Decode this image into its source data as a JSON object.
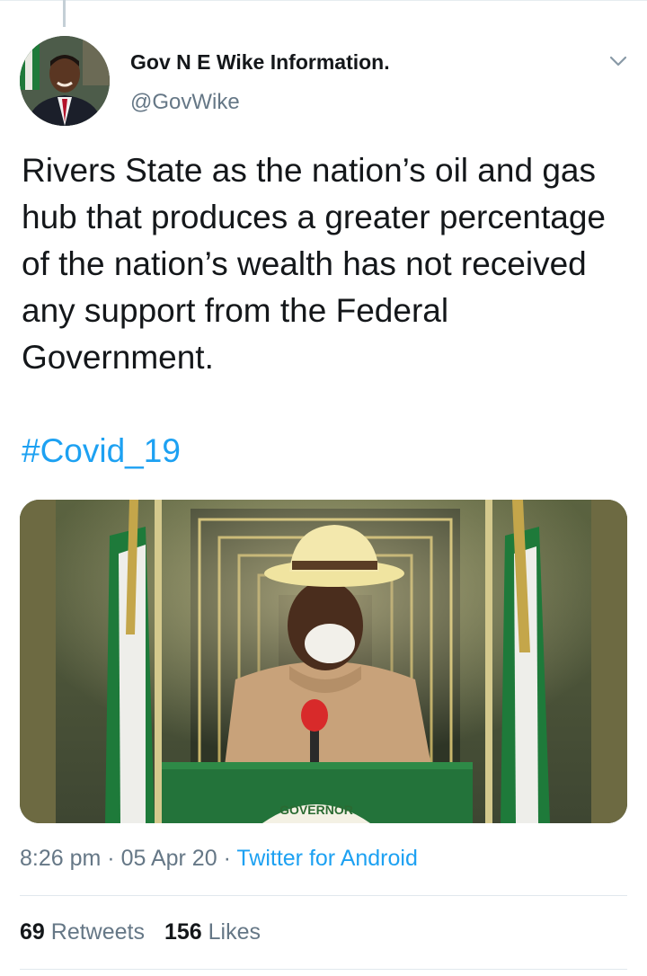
{
  "tweet": {
    "author": {
      "display_name": "Gov N E Wike Information.",
      "handle": "@GovWike"
    },
    "text": "Rivers State as the nation’s oil and gas hub that produces a greater percentage of the nation’s wealth has not received any support from the Federal Government.",
    "hashtag": "#Covid_19",
    "media": {
      "podium_text": "GOVERNOR"
    },
    "time": "8:26 pm",
    "separator": "·",
    "date": "05 Apr 20",
    "source": "Twitter for Android",
    "retweets_count": "69",
    "retweets_label": "Retweets",
    "likes_count": "156",
    "likes_label": "Likes"
  },
  "colors": {
    "link": "#1da1f2",
    "secondary_text": "#657786",
    "primary_text": "#14171a"
  },
  "icons": {
    "caret": "chevron-down-icon"
  }
}
